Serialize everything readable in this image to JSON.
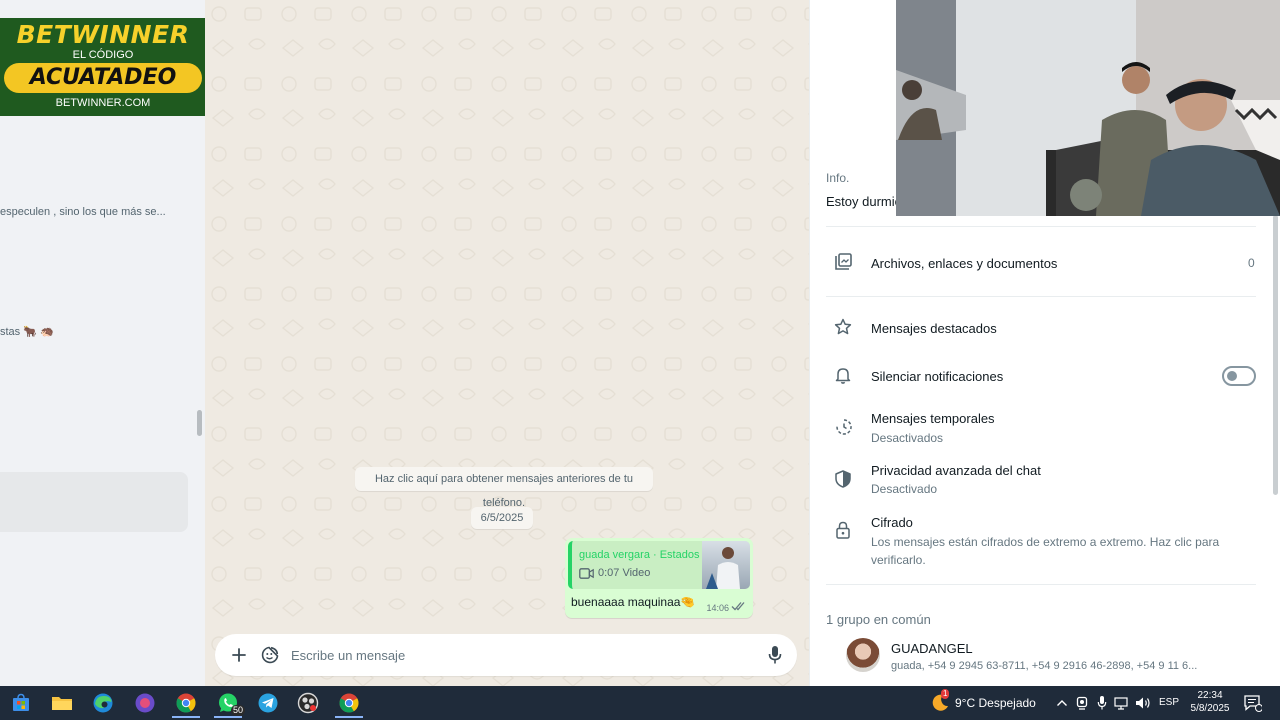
{
  "promo": {
    "brand": "BETWINNER",
    "subtitle": "EL CÓDIGO",
    "code": "ACUATADEO",
    "url": "BETWINNER.COM"
  },
  "chat_list": {
    "preview_1": "especulen , sino los que más se...",
    "preview_2": "stas 🐂 🦔"
  },
  "chat": {
    "older_messages_notice": "Haz clic aquí para obtener mensajes anteriores de tu teléfono.",
    "date_chip": "6/5/2025",
    "message": {
      "quote_author": "guada vergara · Estados",
      "quote_meta": "0:07 Video",
      "text": "buenaaaa maquinaa🤏",
      "time": "14:06",
      "status": "read"
    },
    "composer": {
      "placeholder": "Escribe un mensaje"
    }
  },
  "contact_info": {
    "info_label": "Info.",
    "info_text": "Estoy durmie",
    "items": {
      "files": {
        "label": "Archivos, enlaces y documentos",
        "count": "0"
      },
      "starred": {
        "label": "Mensajes destacados"
      },
      "mute": {
        "label": "Silenciar notificaciones",
        "enabled": false
      },
      "disappearing": {
        "label": "Mensajes temporales",
        "sub": "Desactivados"
      },
      "privacy": {
        "label": "Privacidad avanzada del chat",
        "sub": "Desactivado"
      },
      "encryption": {
        "label": "Cifrado",
        "sub": "Los mensajes están cifrados de extremo a extremo. Haz clic para verificarlo."
      }
    },
    "groups_header": "1 grupo en común",
    "group": {
      "name": "GUADANGEL",
      "members": "guada, +54 9 2945 63-8711, +54 9 2916 46-2898, +54 9 11 6..."
    }
  },
  "taskbar": {
    "whatsapp_badge": "50",
    "weather_alert_badge": "1",
    "weather": "9°C  Despejado",
    "language": "ESP",
    "time": "22:34",
    "date": "5/8/2025"
  },
  "colors": {
    "accent_green": "#25d366",
    "bubble_out": "#d9fdd3",
    "chat_bg": "#efeae2",
    "taskbar": "#1f2b3a"
  }
}
